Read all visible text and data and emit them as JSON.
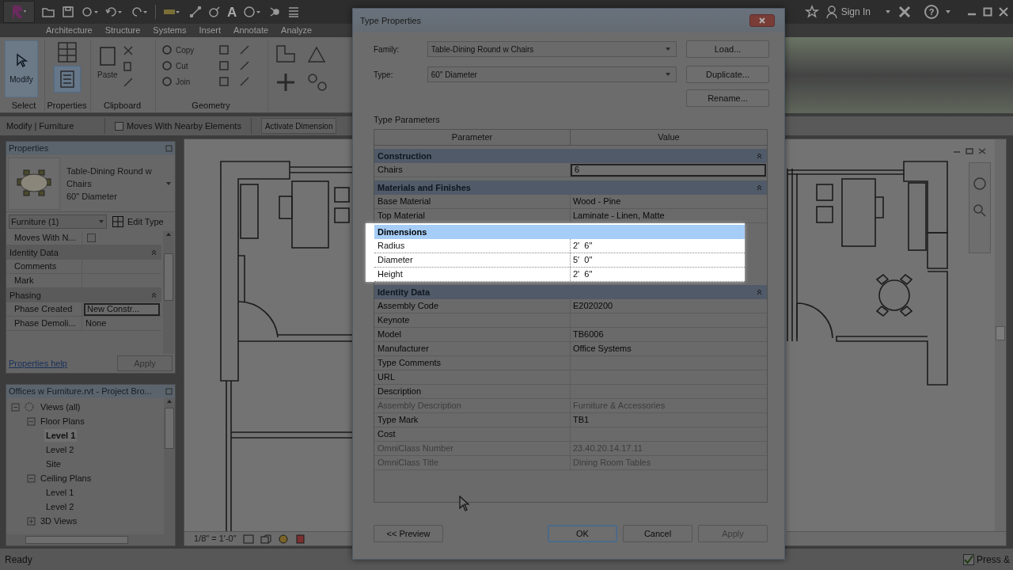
{
  "title_bar": {
    "text_tool_glyph": "A",
    "sign_in": "Sign In",
    "help_glyph": "?"
  },
  "ribbon_tabs": [
    {
      "label": "Architecture"
    },
    {
      "label": "Structure"
    },
    {
      "label": "Systems"
    },
    {
      "label": "Insert"
    },
    {
      "label": "Annotate"
    },
    {
      "label": "Analyze"
    }
  ],
  "ribbon": {
    "modify_button": "Modify",
    "paste_button": "Paste",
    "geometry_buttons": [
      "Copy",
      "Cut",
      "Join"
    ],
    "panel_titles": [
      "Select",
      "Properties",
      "Clipboard",
      "Geometry"
    ]
  },
  "options_bar": {
    "context": "Modify | Furniture",
    "moves_with_nearby": {
      "label": "Moves With Nearby Elements",
      "checked": false
    },
    "activate_dimensions": "Activate Dimension"
  },
  "properties_palette": {
    "title": "Properties",
    "type_name": "Table-Dining Round w Chairs",
    "type_size": "60\" Diameter",
    "filter": "Furniture (1)",
    "edit_type": "Edit Type",
    "rows": [
      {
        "kind": "param",
        "label": "Moves With N...",
        "checked": false
      },
      {
        "kind": "group",
        "label": "Identity Data"
      },
      {
        "kind": "param",
        "label": "Comments"
      },
      {
        "kind": "param",
        "label": "Mark"
      },
      {
        "kind": "group",
        "label": "Phasing"
      },
      {
        "kind": "param",
        "label": "Phase Created",
        "value": "New Constr...",
        "editing": true
      },
      {
        "kind": "param",
        "label": "Phase Demoli...",
        "value": "None",
        "editing": false
      }
    ],
    "help_link": "Properties help",
    "apply": "Apply"
  },
  "project_browser": {
    "title": "Offices w Furniture.rvt - Project Bro...",
    "tree": [
      {
        "label": "Views (all)",
        "expanded": true,
        "selected": false,
        "children": [
          {
            "label": "Floor Plans",
            "expanded": true,
            "selected": false,
            "children": [
              {
                "label": "Level 1",
                "selected": true
              },
              {
                "label": "Level 2",
                "selected": false
              },
              {
                "label": "Site",
                "selected": false
              }
            ]
          },
          {
            "label": "Ceiling Plans",
            "expanded": true,
            "selected": false,
            "children": [
              {
                "label": "Level 1",
                "selected": false
              },
              {
                "label": "Level 2",
                "selected": false
              }
            ]
          },
          {
            "label": "3D Views",
            "expanded": false,
            "selected": false
          }
        ]
      }
    ]
  },
  "view_control_bar": {
    "scale": "1/8\" = 1'-0\""
  },
  "status_bar": {
    "text": "Ready",
    "press_drag": {
      "label": "Press &",
      "checked": true
    }
  },
  "dialog": {
    "title": "Type Properties",
    "family_label": "Family:",
    "family": "Table-Dining Round w Chairs",
    "type_label": "Type:",
    "type": "60\" Diameter",
    "side_buttons": [
      "Load...",
      "Duplicate...",
      "Rename..."
    ],
    "section_label": "Type Parameters",
    "columns": [
      "Parameter",
      "Value"
    ],
    "groups": [
      {
        "name": "Construction",
        "highlighted": false,
        "rows": [
          {
            "parameter": "Chairs",
            "value": "6",
            "editing": true,
            "disabled": false
          }
        ]
      },
      {
        "name": "Materials and Finishes",
        "highlighted": false,
        "rows": [
          {
            "parameter": "Base Material",
            "value": "Wood - Pine",
            "editing": false,
            "disabled": false
          },
          {
            "parameter": "Top Material",
            "value": "Laminate - Linen, Matte",
            "editing": false,
            "disabled": false
          }
        ]
      },
      {
        "name": "Dimensions",
        "highlighted": true,
        "rows": [
          {
            "parameter": "Radius",
            "value": "2'  6\"",
            "editing": false,
            "disabled": false
          },
          {
            "parameter": "Diameter",
            "value": "5'  0\"",
            "editing": false,
            "disabled": false
          },
          {
            "parameter": "Height",
            "value": "2'  6\"",
            "editing": false,
            "disabled": false
          }
        ]
      },
      {
        "name": "Identity Data",
        "highlighted": false,
        "rows": [
          {
            "parameter": "Assembly Code",
            "value": "E2020200",
            "editing": false,
            "disabled": false
          },
          {
            "parameter": "Keynote",
            "editing": false,
            "disabled": false
          },
          {
            "parameter": "Model",
            "value": "TB6006",
            "editing": false,
            "disabled": false
          },
          {
            "parameter": "Manufacturer",
            "value": "Office Systems",
            "editing": false,
            "disabled": false
          },
          {
            "parameter": "Type Comments",
            "editing": false,
            "disabled": false
          },
          {
            "parameter": "URL",
            "editing": false,
            "disabled": false
          },
          {
            "parameter": "Description",
            "editing": false,
            "disabled": false
          },
          {
            "parameter": "Assembly Description",
            "value": "Furniture & Accessories",
            "editing": false,
            "disabled": true
          },
          {
            "parameter": "Type Mark",
            "value": "TB1",
            "editing": false,
            "disabled": false
          },
          {
            "parameter": "Cost",
            "editing": false,
            "disabled": false
          },
          {
            "parameter": "OmniClass Number",
            "value": "23.40.20.14.17.11",
            "editing": false,
            "disabled": true
          },
          {
            "parameter": "OmniClass Title",
            "value": "Dining Room Tables",
            "editing": false,
            "disabled": true
          }
        ]
      }
    ],
    "footer_buttons": [
      {
        "label": "<< Preview",
        "default": false,
        "disabled": false
      },
      {
        "label": "OK",
        "default": true,
        "disabled": false
      },
      {
        "label": "Cancel",
        "default": false,
        "disabled": false
      },
      {
        "label": "Apply",
        "default": false,
        "disabled": true
      }
    ]
  }
}
